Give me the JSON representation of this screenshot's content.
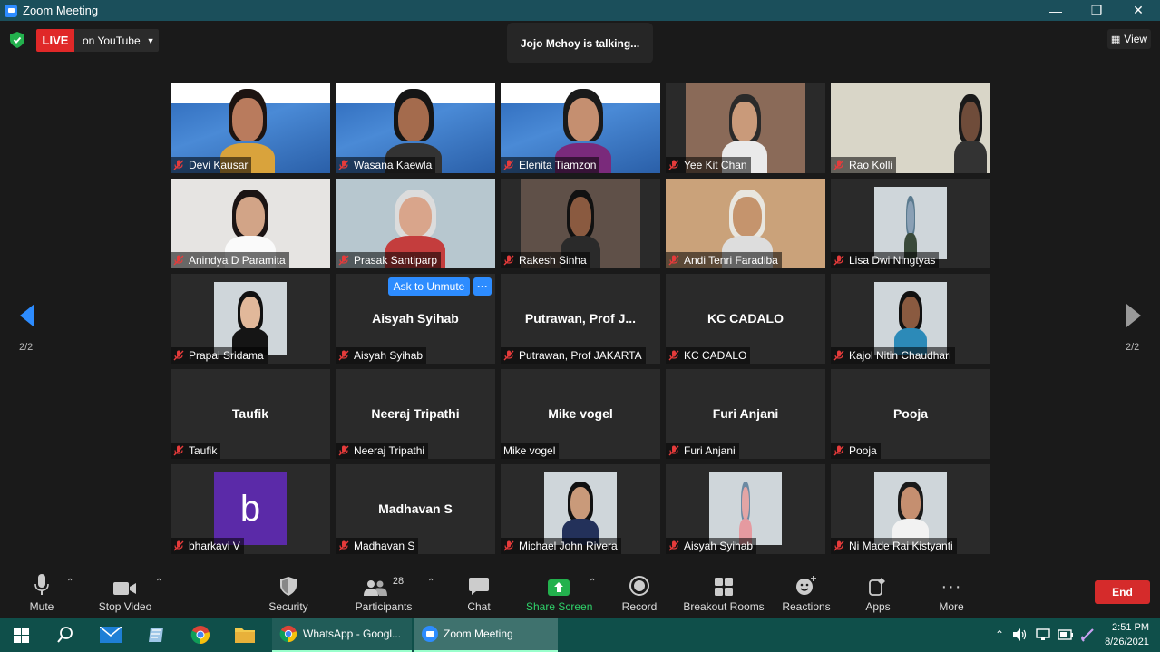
{
  "window": {
    "title": "Zoom Meeting"
  },
  "top": {
    "live_label": "LIVE",
    "stream_target": "on YouTube",
    "speaker_status": "Jojo Mehoy is talking...",
    "view_label": "View",
    "page_left": "2/2",
    "page_right": "2/2"
  },
  "tile_actions": {
    "ask_unmute": "Ask to Unmute",
    "more": "···"
  },
  "participants": [
    {
      "name": "Devi Kausar",
      "big": "",
      "video": true
    },
    {
      "name": "Wasana Kaewla",
      "big": "",
      "video": true
    },
    {
      "name": "Elenita Tiamzon",
      "big": "",
      "video": true
    },
    {
      "name": "Yee Kit Chan",
      "big": "",
      "video": true
    },
    {
      "name": "Rao Kolli",
      "big": "",
      "video": true
    },
    {
      "name": "Anindya D Paramita",
      "big": "",
      "video": true
    },
    {
      "name": "Prasak Santiparp",
      "big": "",
      "video": true
    },
    {
      "name": "Rakesh Sinha",
      "big": "",
      "video": true
    },
    {
      "name": "Andi Tenri Faradiba",
      "big": "",
      "video": true
    },
    {
      "name": "Lisa Dwi Ningtyas",
      "big": "",
      "video": true
    },
    {
      "name": "Prapai Sridama",
      "big": "",
      "video": true
    },
    {
      "name": "Aisyah Syihab",
      "big": "Aisyah Syihab",
      "video": false
    },
    {
      "name": "Putrawan, Prof JAKARTA",
      "big": "Putrawan, Prof J...",
      "video": false
    },
    {
      "name": "KC CADALO",
      "big": "KC CADALO",
      "video": false
    },
    {
      "name": "Kajol Nitin Chaudhari",
      "big": "",
      "video": true
    },
    {
      "name": "Taufik",
      "big": "Taufik",
      "video": false
    },
    {
      "name": "Neeraj Tripathi",
      "big": "Neeraj Tripathi",
      "video": false
    },
    {
      "name": "Mike vogel",
      "big": "Mike vogel",
      "video": false
    },
    {
      "name": "Furi Anjani",
      "big": "Furi Anjani",
      "video": false
    },
    {
      "name": "Pooja",
      "big": "Pooja",
      "video": false
    },
    {
      "name": "bharkavi V",
      "big": "",
      "video": true
    },
    {
      "name": "Madhavan S",
      "big": "Madhavan S",
      "video": false
    },
    {
      "name": "Michael John Rivera",
      "big": "",
      "video": true
    },
    {
      "name": "Aisyah Syihab",
      "big": "",
      "video": true
    },
    {
      "name": "Ni Made Rai Kistyanti",
      "big": "",
      "video": true
    }
  ],
  "avatar_letter": "b",
  "toolbar": {
    "mute": "Mute",
    "stop_video": "Stop Video",
    "security": "Security",
    "participants": "Participants",
    "participants_count": "28",
    "chat": "Chat",
    "share_screen": "Share Screen",
    "record": "Record",
    "breakout": "Breakout Rooms",
    "reactions": "Reactions",
    "apps": "Apps",
    "more": "More",
    "end": "End"
  },
  "taskbar": {
    "whatsapp": "WhatsApp - Googl...",
    "zoom": "Zoom Meeting",
    "time": "2:51 PM",
    "date": "8/26/2021"
  },
  "colors": {
    "accent": "#2d8cff",
    "live_red": "#e02828",
    "end_red": "#d52b2b",
    "share_green": "#2fd16a",
    "mute_red": "#e63b3b"
  }
}
